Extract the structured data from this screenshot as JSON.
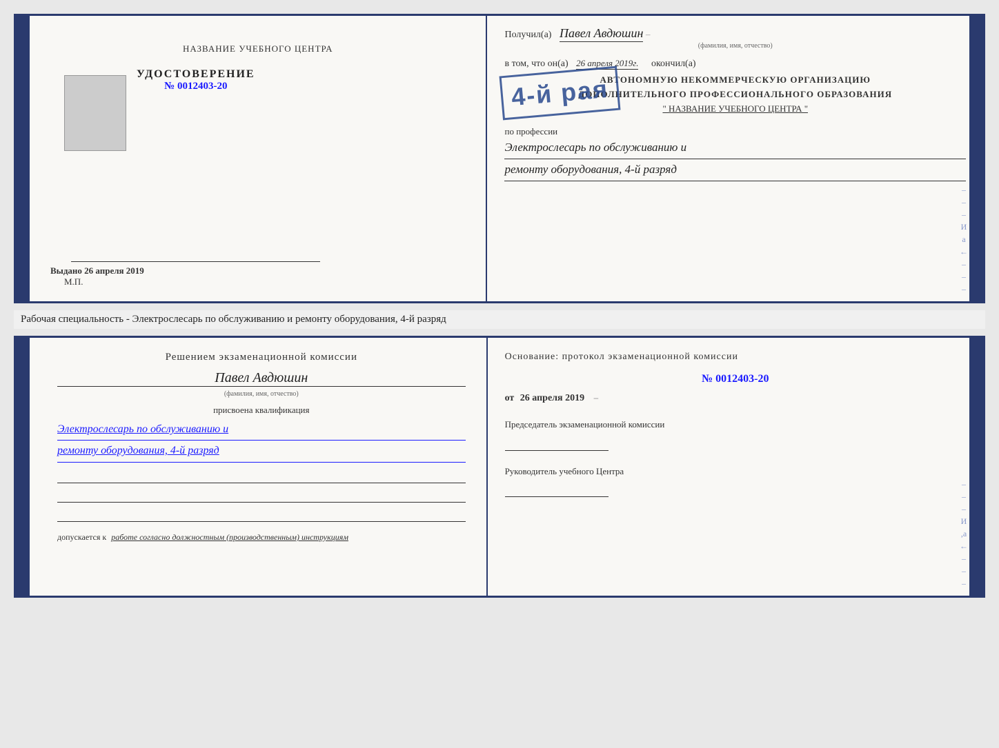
{
  "top_doc": {
    "left": {
      "center_title": "НАЗВАНИЕ УЧЕБНОГО ЦЕНТРА",
      "cert_title": "УДОСТОВЕРЕНИЕ",
      "cert_number_prefix": "№",
      "cert_number": "0012403-20",
      "issued_label": "Выдано",
      "issued_date": "26 апреля 2019",
      "mp_label": "М.П."
    },
    "right": {
      "received_label": "Получил(а)",
      "person_name": "Павел Авдюшин",
      "fio_sublabel": "(фамилия, имя, отчество)",
      "vtom_label": "в том, что он(а)",
      "completed_date": "26 апреля 2019г.",
      "okonchil_label": "окончил(а)",
      "stamp_number": "4-й рая",
      "org_line1": "АВТОНОМНУЮ НЕКОММЕРЧЕСКУЮ ОРГАНИЗАЦИЮ",
      "org_line2": "ДОПОЛНИТЕЛЬНОГО ПРОФЕССИОНАЛЬНОГО ОБРАЗОВАНИЯ",
      "org_line3": "\" НАЗВАНИЕ УЧЕБНОГО ЦЕНТРА \"",
      "profession_label": "по профессии",
      "profession_line1": "Электрослесарь по обслуживанию и",
      "profession_line2": "ремонту оборудования, 4-й разряд"
    }
  },
  "middle_text": "Рабочая специальность - Электрослесарь по обслуживанию и ремонту оборудования, 4-й разряд",
  "bottom_doc": {
    "left": {
      "commission_title": "Решением экзаменационной  комиссии",
      "person_name": "Павел Авдюшин",
      "fio_sublabel": "(фамилия, имя, отчество)",
      "assigned_label": "присвоена квалификация",
      "qualification_line1": "Электрослесарь по обслуживанию и",
      "qualification_line2": "ремонту оборудования, 4-й разряд",
      "допускается_prefix": "допускается к",
      "допускается_text": "работе согласно должностным (производственным) инструкциям"
    },
    "right": {
      "osnov_label": "Основание: протокол экзаменационной  комиссии",
      "protocol_number_prefix": "№",
      "protocol_number": "0012403-20",
      "ot_label": "от",
      "ot_date": "26 апреля 2019",
      "chairman_label": "Председатель экзаменационной комиссии",
      "head_label": "Руководитель учебного Центра"
    }
  },
  "side_chars": {
    "char1": "И",
    "char2": "а",
    "char3": "←",
    "dash": "–"
  }
}
